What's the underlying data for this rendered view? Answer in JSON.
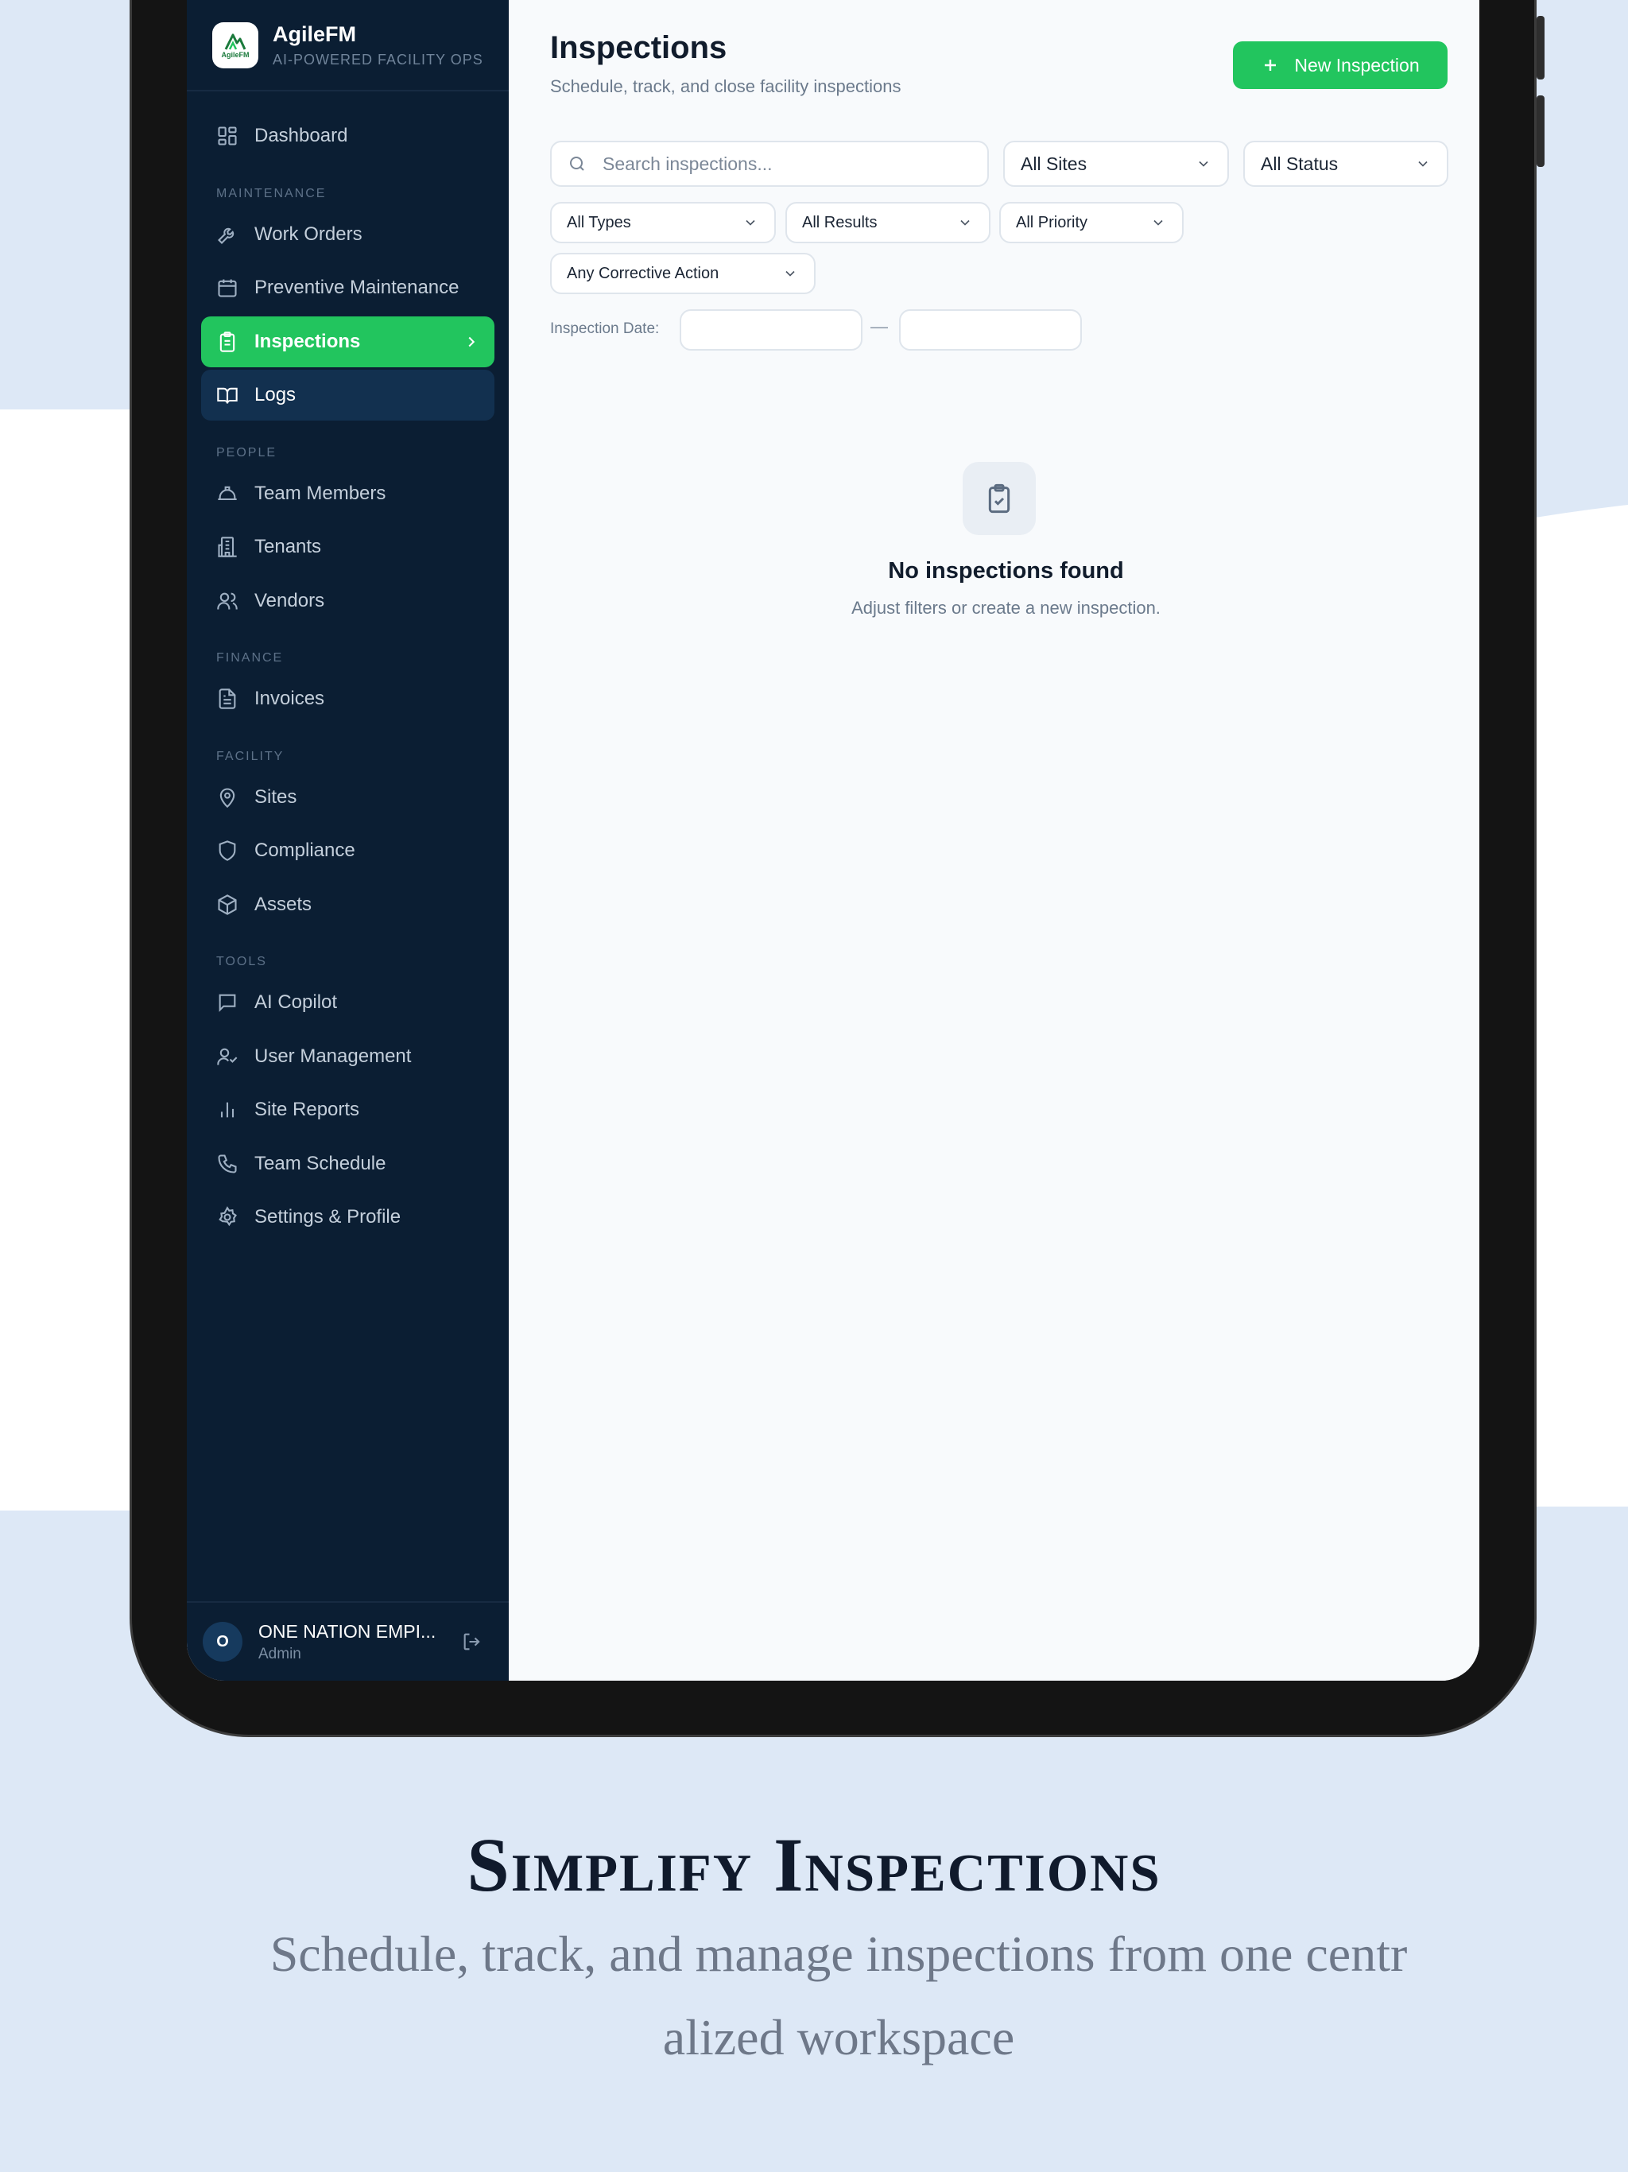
{
  "app": {
    "name": "AgileFM",
    "tagline": "AI-POWERED FACILITY OPS",
    "logo_text": "AgileFM"
  },
  "sidebar": {
    "items_top": [
      {
        "label": "Dashboard",
        "icon": "dashboard-icon"
      }
    ],
    "sections": [
      {
        "title": "MAINTENANCE",
        "items": [
          {
            "label": "Work Orders",
            "icon": "wrench-icon"
          },
          {
            "label": "Preventive Maintenance",
            "icon": "calendar-icon"
          },
          {
            "label": "Inspections",
            "icon": "clipboard-icon",
            "active": true
          },
          {
            "label": "Logs",
            "icon": "book-icon"
          }
        ]
      },
      {
        "title": "PEOPLE",
        "items": [
          {
            "label": "Team Members",
            "icon": "hard-hat-icon"
          },
          {
            "label": "Tenants",
            "icon": "building-icon"
          },
          {
            "label": "Vendors",
            "icon": "users-icon"
          }
        ]
      },
      {
        "title": "FINANCE",
        "items": [
          {
            "label": "Invoices",
            "icon": "document-icon"
          }
        ]
      },
      {
        "title": "FACILITY",
        "items": [
          {
            "label": "Sites",
            "icon": "map-pin-icon"
          },
          {
            "label": "Compliance",
            "icon": "shield-icon"
          },
          {
            "label": "Assets",
            "icon": "box-icon"
          }
        ]
      },
      {
        "title": "TOOLS",
        "items": [
          {
            "label": "AI Copilot",
            "icon": "chat-icon"
          },
          {
            "label": "User Management",
            "icon": "user-check-icon"
          },
          {
            "label": "Site Reports",
            "icon": "bar-chart-icon"
          },
          {
            "label": "Team Schedule",
            "icon": "phone-icon"
          },
          {
            "label": "Settings & Profile",
            "icon": "gear-icon"
          }
        ]
      }
    ],
    "user": {
      "initial": "O",
      "name": "ONE NATION EMPI...",
      "role": "Admin"
    }
  },
  "main": {
    "title": "Inspections",
    "subtitle": "Schedule, track, and close facility inspections",
    "new_button_label": "New Inspection",
    "search_placeholder": "Search inspections...",
    "filters": {
      "sites": "All Sites",
      "status": "All Status",
      "types": "All Types",
      "results": "All Results",
      "priority": "All Priority",
      "corrective_action": "Any Corrective Action"
    },
    "date_label": "Inspection Date:",
    "date_separator": "—",
    "empty_title": "No inspections found",
    "empty_subtitle": "Adjust filters or create a new inspection."
  },
  "marketing": {
    "headline": "Simplify Inspections",
    "tagline": "Schedule, track, and manage inspections from one centralized workspace"
  },
  "colors": {
    "sidebar_bg": "#0b1e33",
    "accent": "#22c55e",
    "page_bg": "#dde8f6",
    "main_bg": "#f8fafc"
  }
}
